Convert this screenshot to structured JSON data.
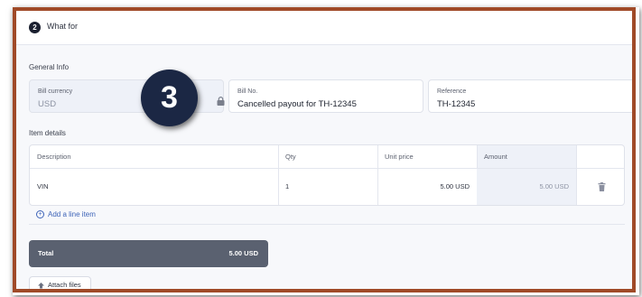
{
  "section": {
    "step": "2",
    "title": "What for"
  },
  "general_info": {
    "heading": "General Info",
    "bill_currency": {
      "label": "Bill currency",
      "value": "USD"
    },
    "bill_no": {
      "label": "Bill No.",
      "value": "Cancelled payout for TH-12345"
    },
    "reference": {
      "label": "Reference",
      "value": "TH-12345"
    }
  },
  "step_marker": "3",
  "item_details": {
    "heading": "Item details",
    "columns": [
      "Description",
      "Qty",
      "Unit price",
      "Amount"
    ],
    "rows": [
      {
        "description": "VIN",
        "qty": "1",
        "unit_price": "5.00 USD",
        "amount": "5.00 USD"
      }
    ],
    "add_line_label": "Add a line item"
  },
  "total": {
    "label": "Total",
    "value": "5.00 USD"
  },
  "attach_files_label": "Attach files",
  "colors": {
    "frame_border": "#a04a28",
    "total_bar": "#5a6170",
    "link": "#3e64b8",
    "marker": "#1b2744"
  }
}
